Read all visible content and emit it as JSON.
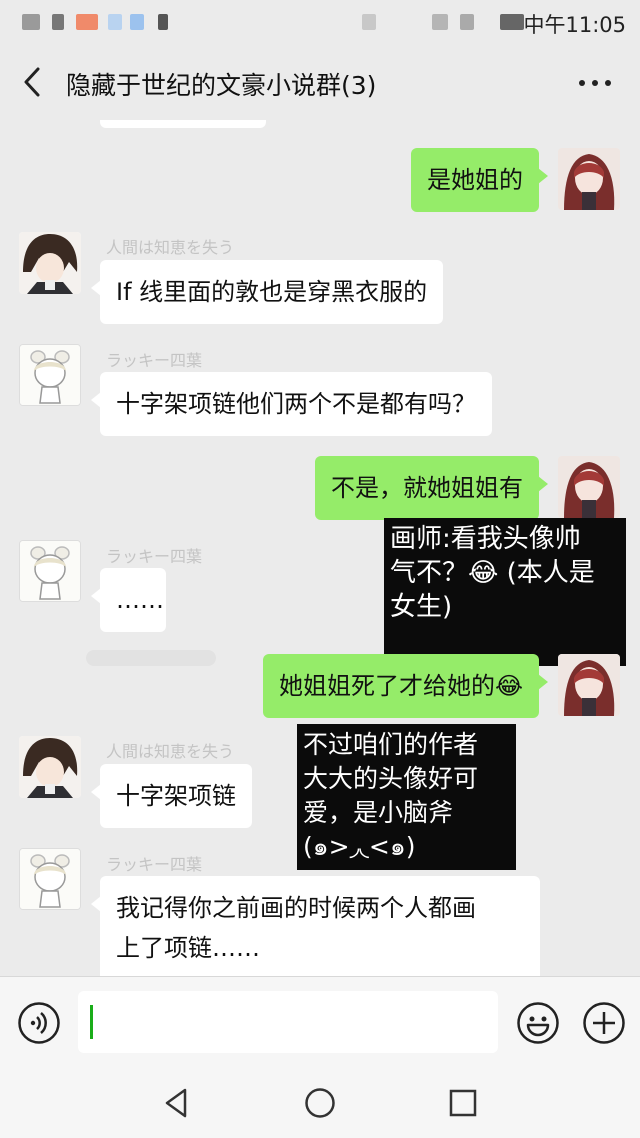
{
  "status_bar": {
    "time": "中午11:05"
  },
  "header": {
    "title": "隐藏于世纪的文豪小说群(3)"
  },
  "messages": {
    "m1": {
      "text": "是她姐的"
    },
    "m2": {
      "sender": "人間は知恵を失う",
      "text": "If 线里面的敦也是穿黑衣服的"
    },
    "m3": {
      "sender": "ラッキー四葉",
      "text": "十字架项链他们两个不是都有吗？"
    },
    "m4": {
      "text": "不是，就她姐姐有"
    },
    "m5": {
      "sender": "ラッキー四葉",
      "text": "……"
    },
    "m6": {
      "text": "她姐姐死了才给她的😂"
    },
    "m7": {
      "sender": "人間は知恵を失う",
      "text": "十字架项链"
    },
    "m8": {
      "sender": "ラッキー四葉",
      "line1": "我记得你之前画的时候两个人都画",
      "line2": "上了项链……"
    }
  },
  "overlays": {
    "o1": {
      "line1": "画师:看我头像帅",
      "line2": "气不？😂 (本人是",
      "line3": "女生)"
    },
    "o2": {
      "line1": "不过咱们的作者",
      "line2": "大大的头像好可",
      "line3": "爱，是小脑斧",
      "line4": "(๑>◞◟<๑)"
    }
  },
  "colors": {
    "background": "#ebebeb",
    "outgoing_bubble": "#95ec69",
    "incoming_bubble": "#ffffff",
    "overlay": "#0b0b0b",
    "cursor": "#1aad19"
  },
  "icons": [
    "back-arrow",
    "more-dots",
    "voice",
    "emoji",
    "plus",
    "nav-back",
    "nav-home",
    "nav-recents"
  ]
}
